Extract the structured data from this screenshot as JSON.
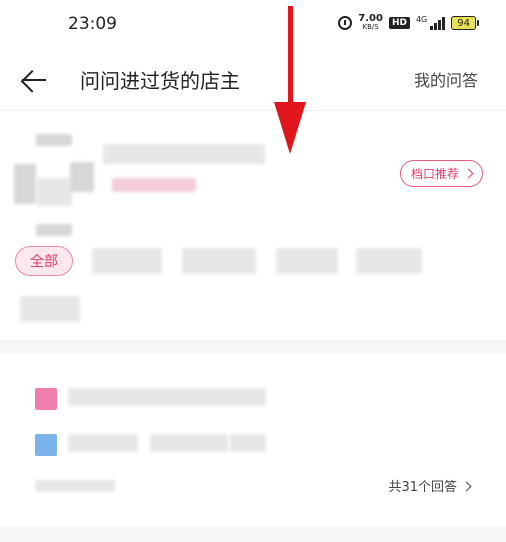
{
  "status_bar": {
    "time": "23:09",
    "speed_value": "7.00",
    "speed_unit": "KB/S",
    "hd_label": "HD",
    "network": "4G",
    "battery": "94"
  },
  "nav": {
    "title": "问问进过货的店主",
    "my_questions": "我的问答"
  },
  "shop": {
    "recommend_button": "档口推荐"
  },
  "filters": {
    "all_label": "全部"
  },
  "qa": {
    "total_answers": "共31个回答"
  },
  "colors": {
    "accent": "#e03d6a",
    "annotation_arrow": "#e0161c"
  }
}
